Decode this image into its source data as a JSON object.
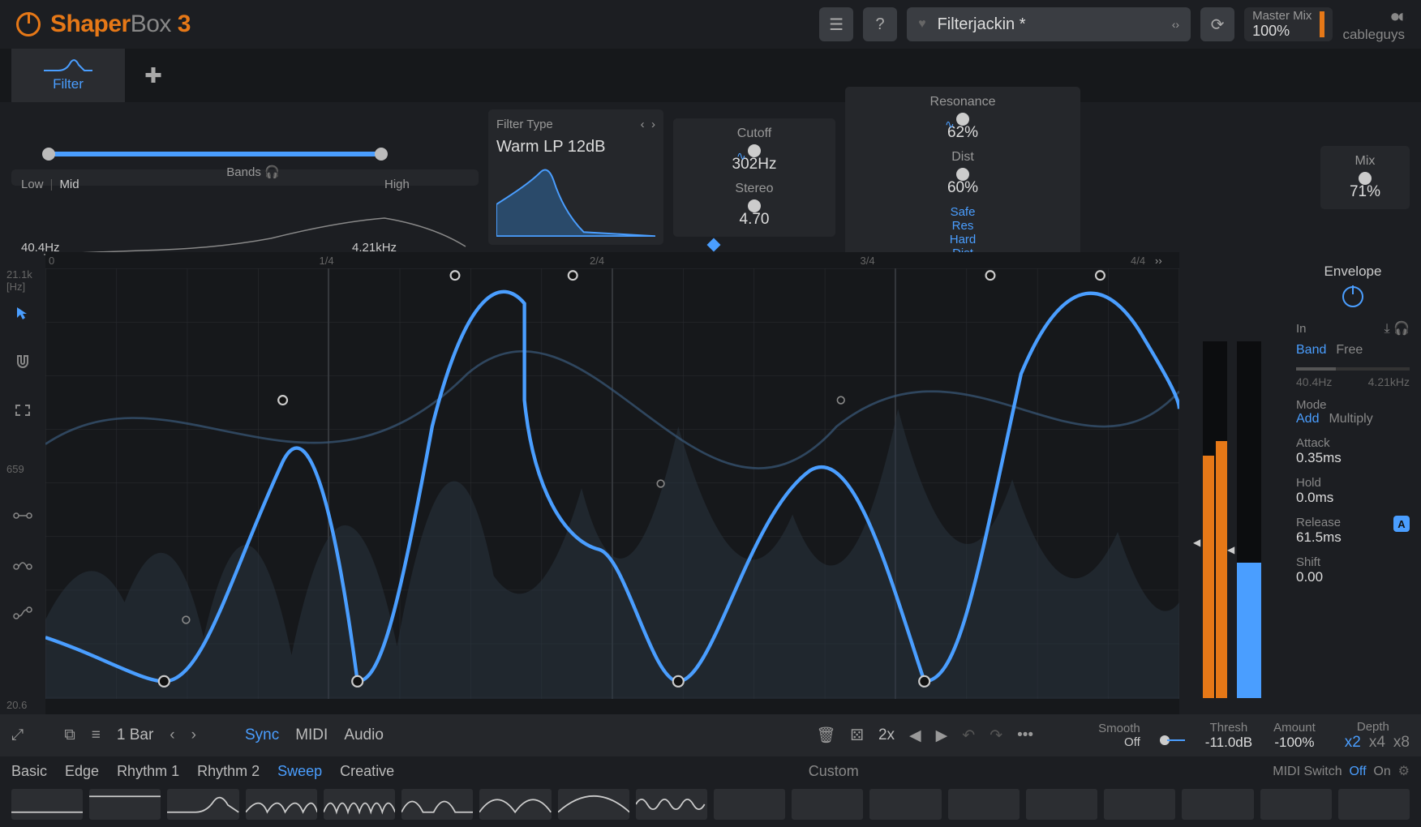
{
  "header": {
    "app_name_1": "Shaper",
    "app_name_2": "Box ",
    "app_name_3": "3",
    "preset": "Filterjackin *",
    "master_label": "Master Mix",
    "master_value": "100%",
    "brand": "cableguys"
  },
  "tabs": {
    "filter": "Filter"
  },
  "bands": {
    "low": "Low",
    "mid": "Mid",
    "high": "High",
    "lo_freq": "40.4Hz",
    "hi_freq": "4.21kHz",
    "label": "Bands"
  },
  "filter_type": {
    "label": "Filter Type",
    "name": "Warm LP 12dB"
  },
  "params": {
    "cutoff": {
      "label": "Cutoff",
      "value": "302Hz",
      "fill": 55
    },
    "stereo": {
      "label": "Stereo",
      "value": "4.70",
      "fill": 82
    },
    "resonance": {
      "label": "Resonance",
      "value": "62%",
      "fill": 62
    },
    "dist": {
      "label": "Dist",
      "value": "60%",
      "fill": 60
    },
    "mix": {
      "label": "Mix",
      "value": "71%",
      "fill": 71
    },
    "safe_res": "Safe\nRes",
    "hard_dist": "Hard\nDist"
  },
  "axis": {
    "y_top": "21.1k",
    "y_unit": "[Hz]",
    "y_mid": "659",
    "y_bot": "20.6",
    "x": [
      "0",
      "1/4",
      "2/4",
      "3/4",
      "4/4"
    ]
  },
  "ctrlbar": {
    "length": "1 Bar",
    "sync": "Sync",
    "midi": "MIDI",
    "audio": "Audio",
    "x2": "2x",
    "smooth_l": "Smooth",
    "smooth_v": "Off"
  },
  "bottom": {
    "thresh_l": "Thresh",
    "thresh_v": "-11.0dB",
    "amount_l": "Amount",
    "amount_v": "-100%",
    "depth_l": "Depth",
    "depth_o": [
      "x2",
      "x4",
      "x8"
    ]
  },
  "env": {
    "title": "Envelope",
    "in": "In",
    "band": "Band",
    "free": "Free",
    "lo": "40.4Hz",
    "hi": "4.21kHz",
    "mode_l": "Mode",
    "mode_add": "Add",
    "mode_mult": "Multiply",
    "attack_l": "Attack",
    "attack_v": "0.35ms",
    "hold_l": "Hold",
    "hold_v": "0.0ms",
    "release_l": "Release",
    "release_v": "61.5ms",
    "shift_l": "Shift",
    "shift_v": "0.00"
  },
  "cats": [
    "Basic",
    "Edge",
    "Rhythm 1",
    "Rhythm 2",
    "Sweep",
    "Creative"
  ],
  "custom": "Custom",
  "midi_switch": {
    "label": "MIDI Switch",
    "off": "Off",
    "on": "On"
  }
}
